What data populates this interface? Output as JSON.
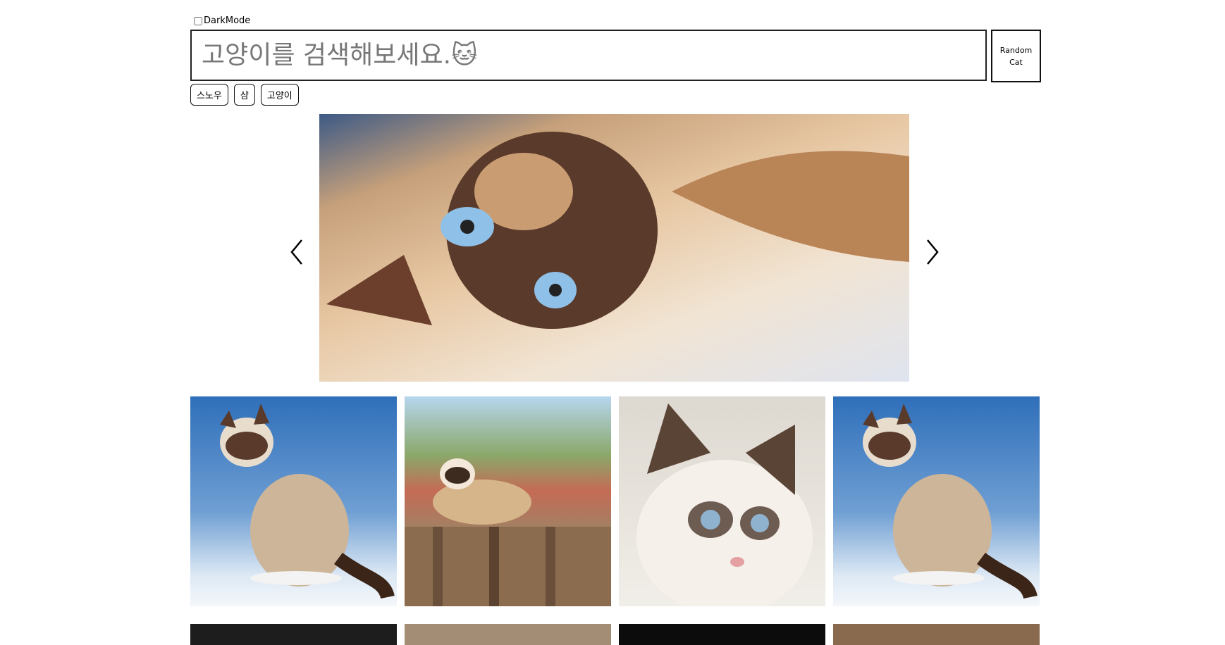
{
  "darkmode": {
    "label": "DarkMode"
  },
  "search": {
    "placeholder": "고양이를 검색해보세요.🐱"
  },
  "random_button": {
    "label": "Random Cat"
  },
  "keywords": [
    "스노우",
    "샴",
    "고양이"
  ],
  "banner": {
    "image": "siamese-cat-lying-on-blanket"
  },
  "results": [
    {
      "image": "snowshoe-cat-sitting-blue-background"
    },
    {
      "image": "snowshoe-cat-on-wooden-fence"
    },
    {
      "image": "snowshoe-kitten-face"
    },
    {
      "image": "snowshoe-cat-sitting-blue-background"
    },
    {
      "image": "cat-dark-background"
    },
    {
      "image": "cat-tan-background"
    },
    {
      "image": "cat-black-background"
    },
    {
      "image": "cat-brown-background"
    }
  ]
}
